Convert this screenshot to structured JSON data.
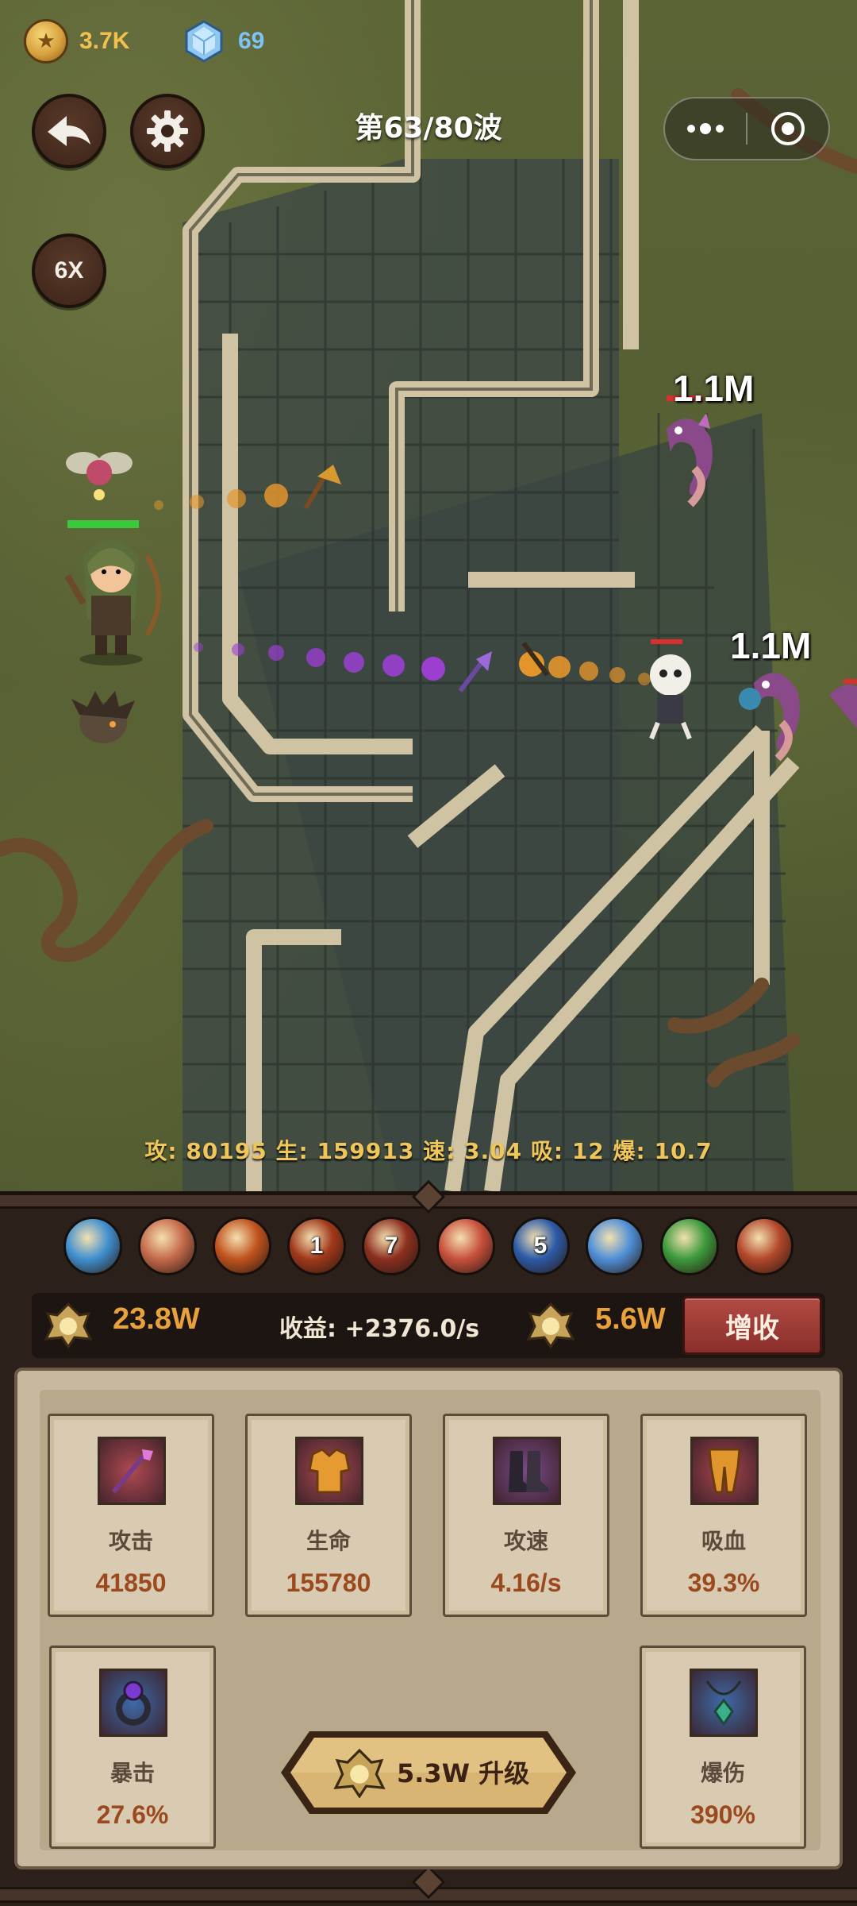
{
  "top_bar": {
    "coins": "3.7K",
    "gems": "69",
    "wave": "第63/80波",
    "speed": "6X"
  },
  "battle": {
    "damage_labels": [
      "1.1M",
      "1.1M"
    ],
    "stats": "攻: 80195 生: 159913 速: 3.04 吸: 12 爆: 10.7"
  },
  "skills": [
    {
      "icon": "whirlwind-skill-icon",
      "num": "",
      "color": "#3f8fd0"
    },
    {
      "icon": "sword-skill-icon",
      "num": "",
      "color": "#c56a4a"
    },
    {
      "icon": "fireball-skill-icon",
      "num": "",
      "color": "#c0521e"
    },
    {
      "icon": "flame-skill-icon",
      "num": "1",
      "color": "#a0381a"
    },
    {
      "icon": "meteor-skill-icon",
      "num": "7",
      "color": "#8c2f20"
    },
    {
      "icon": "heart-skill-icon",
      "num": "",
      "color": "#c8503c"
    },
    {
      "icon": "lightning-skill-icon",
      "num": "5",
      "color": "#2c5aa8"
    },
    {
      "icon": "ice-slash-skill-icon",
      "num": "",
      "color": "#4e8fd8"
    },
    {
      "icon": "heal-cross-skill-icon",
      "num": "",
      "color": "#3c9a3c"
    },
    {
      "icon": "fire-claw-skill-icon",
      "num": "",
      "color": "#b2472a"
    }
  ],
  "income": {
    "left_amount": "23.8W",
    "rate": "收益: +2376.0/s",
    "right_amount": "5.6W",
    "increase_label": "增收"
  },
  "upgrades": [
    {
      "label": "攻击",
      "value": "41850",
      "icon": "staff-icon",
      "bg": "#b04a52"
    },
    {
      "label": "生命",
      "value": "155780",
      "icon": "armor-icon",
      "bg": "#a84a4f"
    },
    {
      "label": "攻速",
      "value": "4.16/s",
      "icon": "boots-icon",
      "bg": "#7a4a86"
    },
    {
      "label": "吸血",
      "value": "39.3%",
      "icon": "leggings-icon",
      "bg": "#a8444c"
    },
    {
      "label": "暴击",
      "value": "27.6%",
      "icon": "ring-icon",
      "bg": "#3f6aa8"
    },
    {
      "label": "爆伤",
      "value": "390%",
      "icon": "amulet-icon",
      "bg": "#3f6aa8"
    }
  ],
  "upgrade_button": {
    "label": "5.3W 升级"
  }
}
